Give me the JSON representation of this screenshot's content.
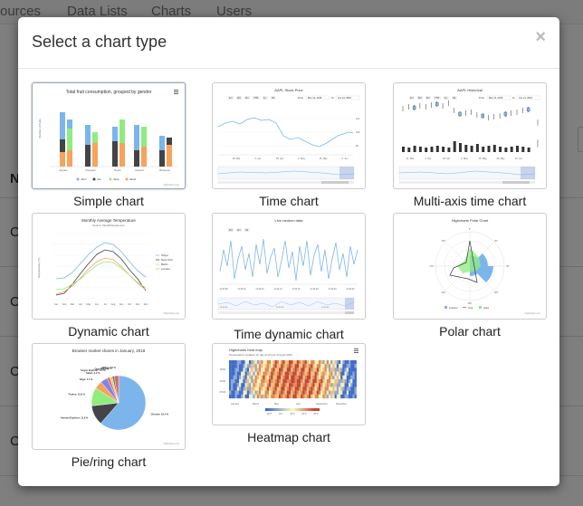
{
  "background": {
    "nav_items": [
      "ources",
      "Data Lists",
      "Charts",
      "Users"
    ],
    "header_letter": "N",
    "row_letters": [
      "C",
      "C",
      "C",
      "C"
    ]
  },
  "modal": {
    "title": "Select a chart type",
    "close_glyph": "×"
  },
  "chart_types": [
    {
      "label": "Simple chart",
      "thumb": {
        "title": "Total fruit consumption, grouped by gender",
        "yaxis_label": "Number of fruits",
        "categories": [
          "Apples",
          "Oranges",
          "Pears",
          "Grapes",
          "Bananas"
        ],
        "legend": [
          "John",
          "Joe",
          "Jane",
          "Janet"
        ],
        "credit": "Highcharts.com"
      }
    },
    {
      "label": "Time chart",
      "thumb": {
        "title": "AAPL Stock Price",
        "zoom": [
          "1m",
          "3m",
          "6m",
          "YTD",
          "1y",
          "All"
        ],
        "from_label": "From",
        "from_value": "Mar 14, 2016",
        "to_label": "To",
        "to_value": "Jun 14, 2016",
        "y_ticks": [
          "110",
          "100",
          "90"
        ],
        "x_ticks": [
          "18. Mar",
          "4. Apr",
          "18. Apr",
          "2. May",
          "16. May",
          "6. Jun"
        ]
      }
    },
    {
      "label": "Multi-axis time chart",
      "thumb": {
        "title": "AAPL Historical",
        "zoom": [
          "1m",
          "3m",
          "6m",
          "YTD",
          "1y",
          "All"
        ],
        "from_label": "From",
        "from_value": "Mar 14, 2016",
        "to_label": "To",
        "to_value": "Jun 14, 2016",
        "right_axis_top": "OHLC",
        "right_axis_bottom": "Volume",
        "x_ticks": [
          "21. Mar",
          "4. Apr",
          "18. Apr",
          "2. May",
          "16. May",
          "30. May",
          "13. Jun"
        ]
      }
    },
    {
      "label": "Dynamic chart",
      "thumb": {
        "title": "Monthly Average Temperature",
        "subtitle": "Source: WorldClimate.com",
        "yaxis_label": "Temperature (°C)",
        "months": [
          "Jan",
          "Feb",
          "Mar",
          "Apr",
          "May",
          "Jun",
          "Jul",
          "Aug",
          "Sep",
          "Oct",
          "Nov",
          "Dec"
        ],
        "legend": [
          "Tokyo",
          "New York",
          "Berlin",
          "London"
        ],
        "credit": "Highcharts.com"
      }
    },
    {
      "label": "Time dynamic chart",
      "thumb": {
        "title": "Live random data",
        "zoom": [
          "1m",
          "3m",
          "All"
        ],
        "x_ticks": [
          "11:42:08",
          "11:42:10",
          "11:42:12",
          "11:42:14",
          "11:42:16",
          "11:42:18",
          "11:42:20",
          "11:42:22"
        ],
        "navigator_ticks": [
          "11:42:00",
          "11:42:30",
          "11:42:40"
        ]
      }
    },
    {
      "label": "Polar chart",
      "thumb": {
        "title": "Highcharts Polar Chart",
        "angles": [
          "0°",
          "45°",
          "90°",
          "135°",
          "180°",
          "225°",
          "270°",
          "315°"
        ],
        "legend": [
          "Column",
          "Line",
          "Area"
        ],
        "credit": "Highcharts.com"
      }
    },
    {
      "label": "Pie/ring chart",
      "thumb": {
        "title": "Browser market shares in January, 2018",
        "slices": [
          {
            "name": "Chrome: 61.4 %",
            "value": 61.4
          },
          {
            "name": "Internet Explorer: 11.8 %",
            "value": 11.8
          },
          {
            "name": "Firefox: 10.9 %",
            "value": 10.9
          },
          {
            "name": "Edge: 4.7 %",
            "value": 4.7
          },
          {
            "name": "Safari: 4.2 %",
            "value": 4.2
          },
          {
            "name": "Sogou Explorer: 1.6 %",
            "value": 1.6
          },
          {
            "name": "Opera: 1.6 %",
            "value": 1.6
          },
          {
            "name": "QQ: 1.2 %",
            "value": 1.2
          },
          {
            "name": "Other: 2.6 %",
            "value": 2.6
          }
        ],
        "credit": "Highcharts.com"
      }
    },
    {
      "label": "Heatmap chart",
      "thumb": {
        "title": "Highcharts heat map",
        "subtitle": "Temperature variation by day and hour through 2013",
        "y_ticks": [
          "18:00",
          "12:00",
          "06:00"
        ],
        "x_ticks": [
          "January",
          "March",
          "May",
          "July",
          "September",
          "November"
        ],
        "scale_ticks": [
          "-10°C",
          "0°C",
          "10°C",
          "20°C",
          "30°C"
        ]
      }
    }
  ]
}
